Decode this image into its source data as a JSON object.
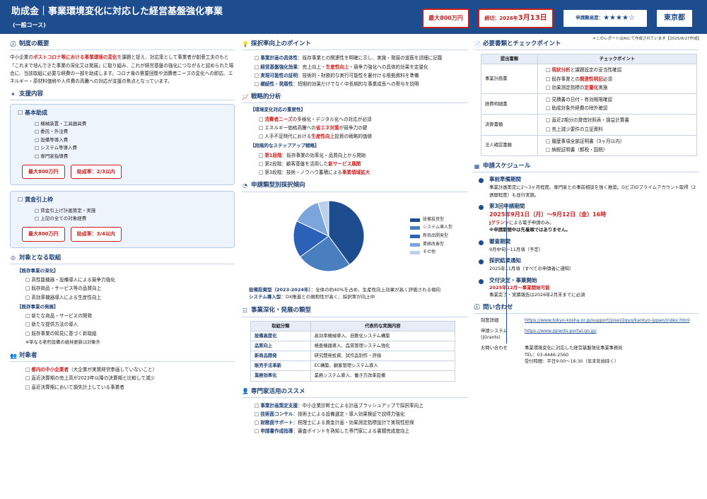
{
  "header": {
    "title": "助成金｜事業環境変化に対応した経営基盤強化事業",
    "subtitle": "(一般コース)",
    "badge_max": "最大800万円",
    "badge_deadline_prefix": "締切：2026年",
    "badge_deadline_date": "3月13日",
    "badge_difficulty_label": "申請難易度：",
    "badge_difficulty_stars": "★★★★☆",
    "badge_region": "東京都"
  },
  "note": "＊このレポートはAIにて作成されています【2025/8/27作成】",
  "overview": {
    "title": "制度の概要",
    "p1": "中小企業の",
    "p1_red": "ポストコロナ等における事業環境の変化",
    "p1_rest": "を課題と捉え、対応策として事業者が創意工夫のもと「これまで培んできた事業の深化又は発展」に取り組み、これが経営基盤の強化につながると認められた場合に、当該取組に必要な経費の一部を助成します。コロナ後の需要回復や消費者ニーズの変化への即応、エネルギー・原材料価格や人件費の高騰への対応が支援の焦点となっています。"
  },
  "support": {
    "title": "支援内容",
    "basic": {
      "title": "基本助成",
      "items": [
        "機械装置・工具器具費",
        "委託・外注費",
        "設備等導入費",
        "システム等導入費",
        "専門家指導費"
      ],
      "max": "最大800万円",
      "rate": "助成率：2/3以内"
    },
    "wage": {
      "title": "賃金引上枠",
      "items": [
        "賃金引上げ計画策定・実施",
        "上記の全ての対象経費"
      ],
      "max": "最大800万円",
      "rate": "助成率：3/4以内"
    }
  },
  "targets": {
    "title": "対象となる取組",
    "deep_title": "【既存事業の深化】",
    "deep": [
      "高性能機器・設備導入による競争力強化",
      "既存商品・サービス等の品質向上",
      "高効率機器導入による生産性向上"
    ],
    "dev_title": "【既存事業の発展】",
    "dev": [
      "新たな商品・サービスの開発",
      "新たな提供方法の導入",
      "既存事業の知見に基づく新取組"
    ],
    "note": "※単なる老朽設備の維持更新は対象外"
  },
  "eligible": {
    "title": "対象者",
    "items_red": "都内の中小企業者",
    "items_red_rest": "（大企業が実質経営参画していないこと）",
    "items": [
      "直近決算期の売上高が2023年以降の決算期と比較して減少",
      "直近決算期において損失計上している事業者"
    ]
  },
  "points": {
    "title": "採択率向上のポイント",
    "items": [
      {
        "b": "事業計画の具体性",
        "t": "：既存事業との関連性を明確に示し、実施・発展の道筋を詳細に記載"
      },
      {
        "b": "経営基盤強化効果",
        "t": "：売上向上・",
        "r": "生産性向上",
        "t2": "・競争力強化への具体的効果を定量化"
      },
      {
        "b": "実現可能性の証明",
        "t": "：技術的・財務的な実行可能性を裏付ける根拠資料を準備"
      },
      {
        "b": "継続性・発展性",
        "t": "：短期的効果だけでなく中長期的な事業成長への寄与を説明"
      }
    ]
  },
  "strategy": {
    "title": "戦略的分析",
    "h1": "【環境変化対応の重要性】",
    "a1": {
      "r": "消費者ニーズ",
      "t": "の多様化・デジタル化への対応が必須"
    },
    "a2": {
      "t": "エネルギー価格高騰への",
      "r": "省エネ対策",
      "t2": "が競争力の鍵"
    },
    "a3": {
      "t": "人手不足時代における",
      "r": "生産性向上",
      "t2": "投資の戦略的価値"
    },
    "h2": "【段階的なステップアップ戦略】",
    "b1": {
      "r": "第1段階",
      "t": "：既存事業の効率化・品質向上から開始"
    },
    "b2": {
      "t": "第2段階：顧客基盤を活用した",
      "r": "新サービス展開"
    },
    "b3": {
      "t": "第3段階：技術・ノウハウ蓄積による",
      "r": "事業領域拡大"
    }
  },
  "pie": {
    "title": "申請類型別採択傾向",
    "caption1_b": "設備投資型（2023-2024年）",
    "caption1": "：全体の約40%を占め、生産性向上効果が高く評価される傾向",
    "caption2_b": "システム導入型",
    "caption2": "：DX推進との親和性が高く、採択率が向上中"
  },
  "chart_data": {
    "type": "pie",
    "categories": [
      "設備投資型",
      "システム導入型",
      "新商品開発型",
      "業務改善型",
      "その他"
    ],
    "values": [
      40,
      25,
      17,
      13,
      5
    ],
    "colors": [
      "#1e4d8f",
      "#4a7fbf",
      "#2b62b8",
      "#7aa6dc",
      "#b9d0ee"
    ],
    "legend": "right"
  },
  "types": {
    "title": "事業深化・発展の類型",
    "head": [
      "取組分類",
      "代表的な実施内容"
    ],
    "rows": [
      [
        "設備高度化",
        "高効率機械導入、自動化システム構築"
      ],
      [
        "品質向上",
        "検査機器導入、品質管理システム強化"
      ],
      [
        "新商品開発",
        "研究開発投資、試作品制作・評価"
      ],
      [
        "販売手法革新",
        "EC構築、顧客管理システム導入"
      ],
      [
        "業務効率化",
        "業務システム導入、働き方改革設備"
      ]
    ]
  },
  "experts": {
    "title": "専門家活用のススメ",
    "items": [
      {
        "b": "事業計画策定支援",
        "t": "：中小企業診断士による計画ブラッシュアップで採択率向上"
      },
      {
        "b": "技術面コンサル",
        "t": "：技術士による設備選定・導入効果検証で説得力強化"
      },
      {
        "b": "財務面サポート",
        "t": "：税理士による資金計画・効果測定指標設計で実現性担保"
      },
      {
        "b": "申請書作成指導",
        "t": "：審査ポイントを熟知した専門家による書類完成度向上"
      }
    ]
  },
  "docs": {
    "title": "必要書類とチェックポイント",
    "head": [
      "提出書類",
      "チェックポイント"
    ],
    "rows": [
      {
        "name": "事業計画書",
        "items": [
          {
            "r": "現状分析",
            "t": "と課題設定の妥当性確認"
          },
          {
            "t": "既存事業との",
            "r": "関連性明記",
            "t2": "必須"
          },
          {
            "t": "効果測定指標の",
            "r": "定量化",
            "t2": "実施"
          }
        ]
      },
      {
        "name": "経費明細書",
        "items": [
          {
            "t": "見積書の日付・有効期限確認"
          },
          {
            "t": "助成対象外経費の除外確認"
          }
        ]
      },
      {
        "name": "決算書類",
        "items": [
          {
            "t": "直近2期分の貸借対照表・損益計算書"
          },
          {
            "t": "売上減少要件の立証資料"
          }
        ]
      },
      {
        "name": "法人確認書類",
        "items": [
          {
            "t": "履歴事項全部証明書（3ヶ月以内）"
          },
          {
            "t": "納税証明書（都税・国税）"
          }
        ]
      }
    ]
  },
  "schedule": {
    "title": "申請スケジュール",
    "s1_h": "事前準備期間",
    "s1_t": "事業計画策定に2〜3ヶ月程度。専門家との事前相談を強く推奨。GビズIDプライムアカウント取得（2週間程度）も並行実施。",
    "s2_h": "第3回申請期間",
    "s2_date": "2025年9月1日（月）〜9月12日（金）16時",
    "s2_t_r": "Jグランツ",
    "s2_t": "による電子申請のみ。",
    "s2_t2": "※申請期間中は先着順ではありません。",
    "s3_h": "審査期間",
    "s3_t": "9月中旬〜11月頃（予定）",
    "s4_h": "採択結果通知",
    "s4_t": "2025年11月頃（すべての申請者に通知）",
    "s5_h": "交付決定・事業開始",
    "s5_r": "2025年12月〜事業開始可能",
    "s5_t": "事業完了・実績報告は2026年2月末までに必須"
  },
  "contact": {
    "title": "問い合わせ",
    "l1": "制度詳細",
    "v1": "https://www.tokyo-kosha.or.jp/support/josei/jigyo/kankyo-ippan/index.html",
    "l2": "申請システム(jGrants)",
    "v2": "https://www.jgrants-portal.go.jp/",
    "l3": "お問い合わせ",
    "v3a": "事業環境変化に対応した経営基盤強化事業事務局",
    "v3b": "TEL：03-4446-2560",
    "v3c": "受付時間：平日9:00〜16:30（年末年始除く）"
  }
}
